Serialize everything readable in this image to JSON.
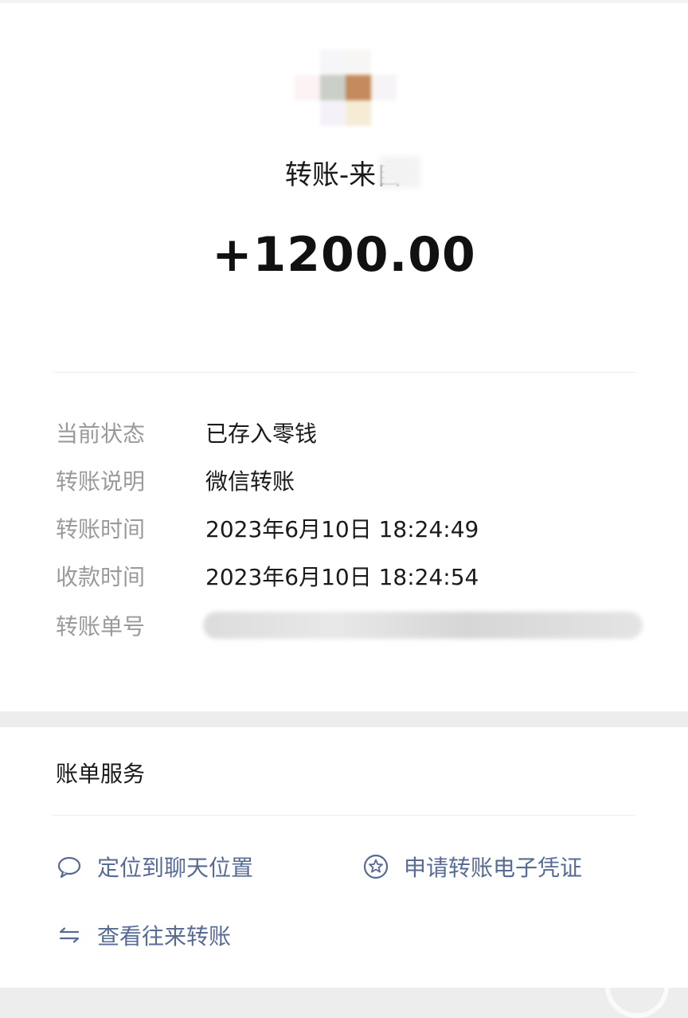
{
  "header": {
    "title": "转账-来自",
    "amount": "+1200.00"
  },
  "details": [
    {
      "label": "当前状态",
      "value": "已存入零钱"
    },
    {
      "label": "转账说明",
      "value": "微信转账"
    },
    {
      "label": "转账时间",
      "value": "2023年6月10日 18:24:49"
    },
    {
      "label": "收款时间",
      "value": "2023年6月10日 18:24:54"
    },
    {
      "label": "转账单号",
      "value": ""
    }
  ],
  "services": {
    "title": "账单服务",
    "items": [
      {
        "label": "定位到聊天位置",
        "icon": "chat-bubble-icon"
      },
      {
        "label": "申请转账电子凭证",
        "icon": "star-badge-icon"
      },
      {
        "label": "查看往来转账",
        "icon": "swap-arrows-icon"
      }
    ]
  },
  "colors": {
    "link": "#576b95",
    "label": "#9a9a9a",
    "text": "#1a1a1a",
    "background": "#ededed"
  }
}
